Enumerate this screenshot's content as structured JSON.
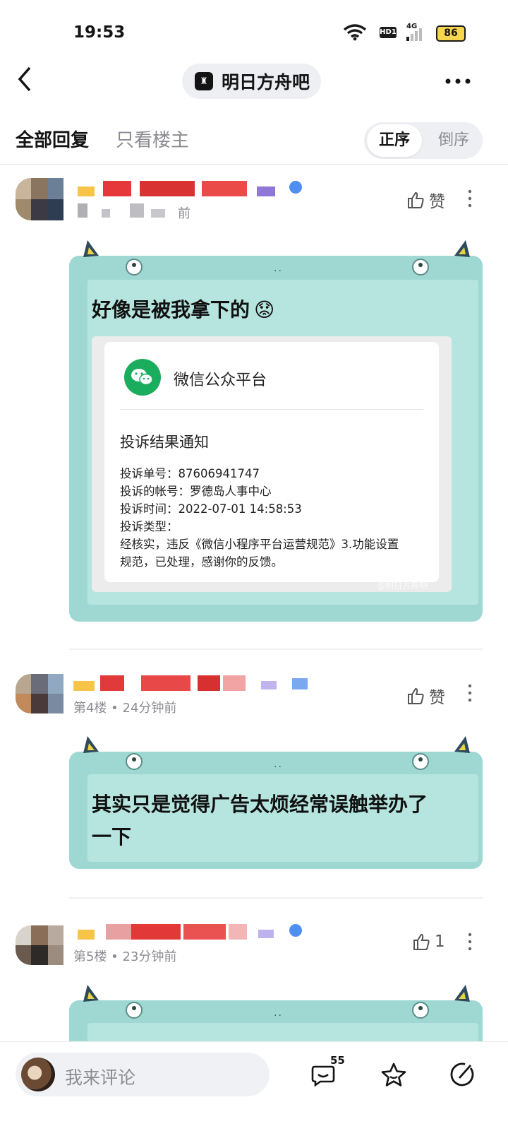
{
  "status_bar": {
    "time": "19:53",
    "hd": "HD1",
    "network": "4G",
    "battery": "86"
  },
  "nav": {
    "forum_name": "明日方舟吧",
    "logo_glyph": "♜"
  },
  "tabs": {
    "all": "全部回复",
    "op_only": "只看楼主"
  },
  "sort": {
    "asc": "正序",
    "desc": "倒序"
  },
  "replies": [
    {
      "meta": "前",
      "like_label": "赞",
      "text": "好像是被我拿下的",
      "emoji": "😟",
      "embedded": {
        "platform": "微信公众平台",
        "title": "投诉结果通知",
        "lines": [
          "投诉单号：87606941747",
          "投诉的帐号：罗德岛人事中心",
          "投诉时间：2022-07-01 14:58:53",
          "投诉类型：",
          "经核实，违反《微信小程序平台运营规范》3.功能设置",
          "规范，已处理，感谢你的反馈。"
        ],
        "watermark": "@明日方舟吧"
      }
    },
    {
      "meta": "第4楼 • 24分钟前",
      "like_label": "赞",
      "text_lines": [
        "其实只是觉得广告太烦经常误触举办了",
        "一下"
      ]
    },
    {
      "meta": "第5楼 • 23分钟前",
      "like_label": "1"
    }
  ],
  "bubble_dots": "..",
  "bottom": {
    "placeholder": "我来评论",
    "comment_count": "55"
  },
  "colors": {
    "bubble": "#9fd8d2",
    "bubble_inner": "#b6e5df",
    "wechat_green": "#1aad5d"
  },
  "icons": [
    "back-icon",
    "more-icon",
    "thumb-up-icon",
    "kebab-icon",
    "wechat-icon",
    "comments-icon",
    "star-icon",
    "share-icon"
  ]
}
